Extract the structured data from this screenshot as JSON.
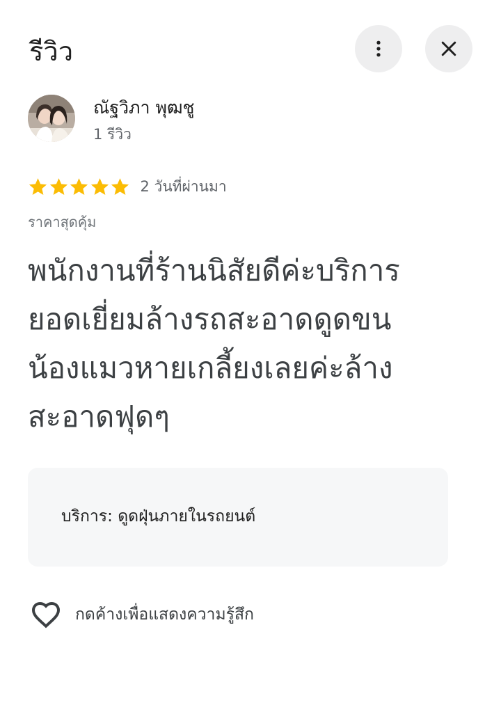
{
  "header": {
    "title": "รีวิว",
    "more_icon": "more-vert-icon",
    "close_icon": "close-icon"
  },
  "reviewer": {
    "name": "ณัฐวิภา พุฒชู",
    "review_count": "1 รีวิว",
    "avatar_icon": "avatar-photo"
  },
  "rating": {
    "stars": 5,
    "max_stars": 5,
    "star_color": "#fbbc04",
    "time": "2 วันที่ผ่านมา"
  },
  "attribute": "ราคาสุดคุ้ม",
  "review": {
    "lines": [
      "พนักงานที่ร้านนิสัยดีค่ะบริการ",
      "ยอดเยี่ยมล้างรถสะอาดดูดขน",
      "น้องแมวหายเกลี้ยงเลยค่ะล้าง",
      "สะอาดฟุดๆ"
    ]
  },
  "service": {
    "text": "บริการ: ดูดฝุ่นภายในรถยนต์"
  },
  "reaction": {
    "label": "กดค้างเพื่อแสดงความรู้สึก",
    "icon": "heart-outline-icon"
  }
}
